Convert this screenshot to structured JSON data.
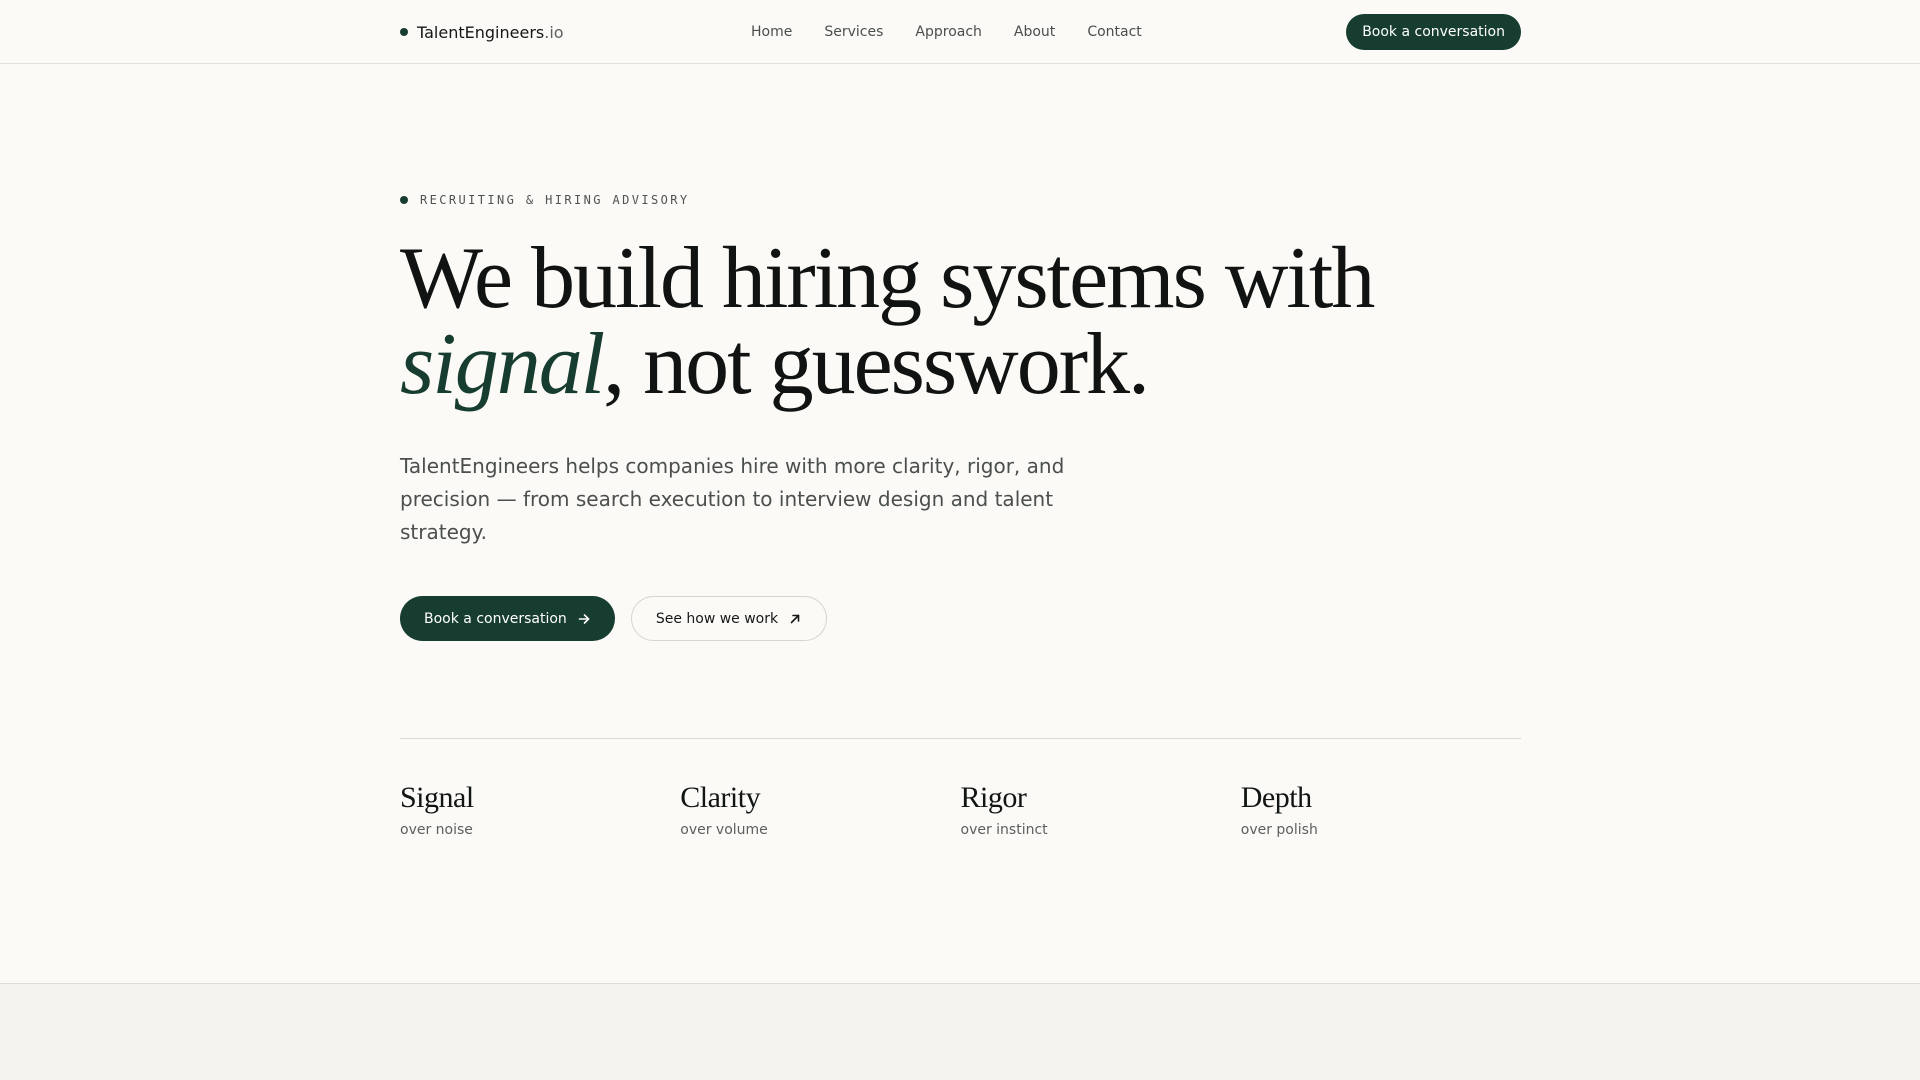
{
  "header": {
    "brand_name": "TalentEngineers",
    "brand_tld": ".io",
    "nav": [
      {
        "label": "Home"
      },
      {
        "label": "Services"
      },
      {
        "label": "Approach"
      },
      {
        "label": "About"
      },
      {
        "label": "Contact"
      }
    ],
    "cta_label": "Book a conversation"
  },
  "hero": {
    "eyebrow": "RECRUITING & HIRING ADVISORY",
    "headline_line1": "We build hiring systems with",
    "headline_accent": "signal",
    "headline_rest": ", not guesswork.",
    "lede": "TalentEngineers helps companies hire with more clarity, rigor, and precision — from search execution to interview design and talent strategy.",
    "primary_cta": "Book a conversation",
    "secondary_cta": "See how we work"
  },
  "principles": [
    {
      "title": "Signal",
      "subtitle": "over noise"
    },
    {
      "title": "Clarity",
      "subtitle": "over volume"
    },
    {
      "title": "Rigor",
      "subtitle": "over instinct"
    },
    {
      "title": "Depth",
      "subtitle": "over polish"
    }
  ],
  "icons": {
    "brand_dot": "dot-icon",
    "primary_cta": "arrow-right-icon",
    "secondary_cta": "arrow-up-right-icon"
  },
  "colors": {
    "accent": "#173d30",
    "background": "#fbfaf7",
    "text": "#111514"
  }
}
